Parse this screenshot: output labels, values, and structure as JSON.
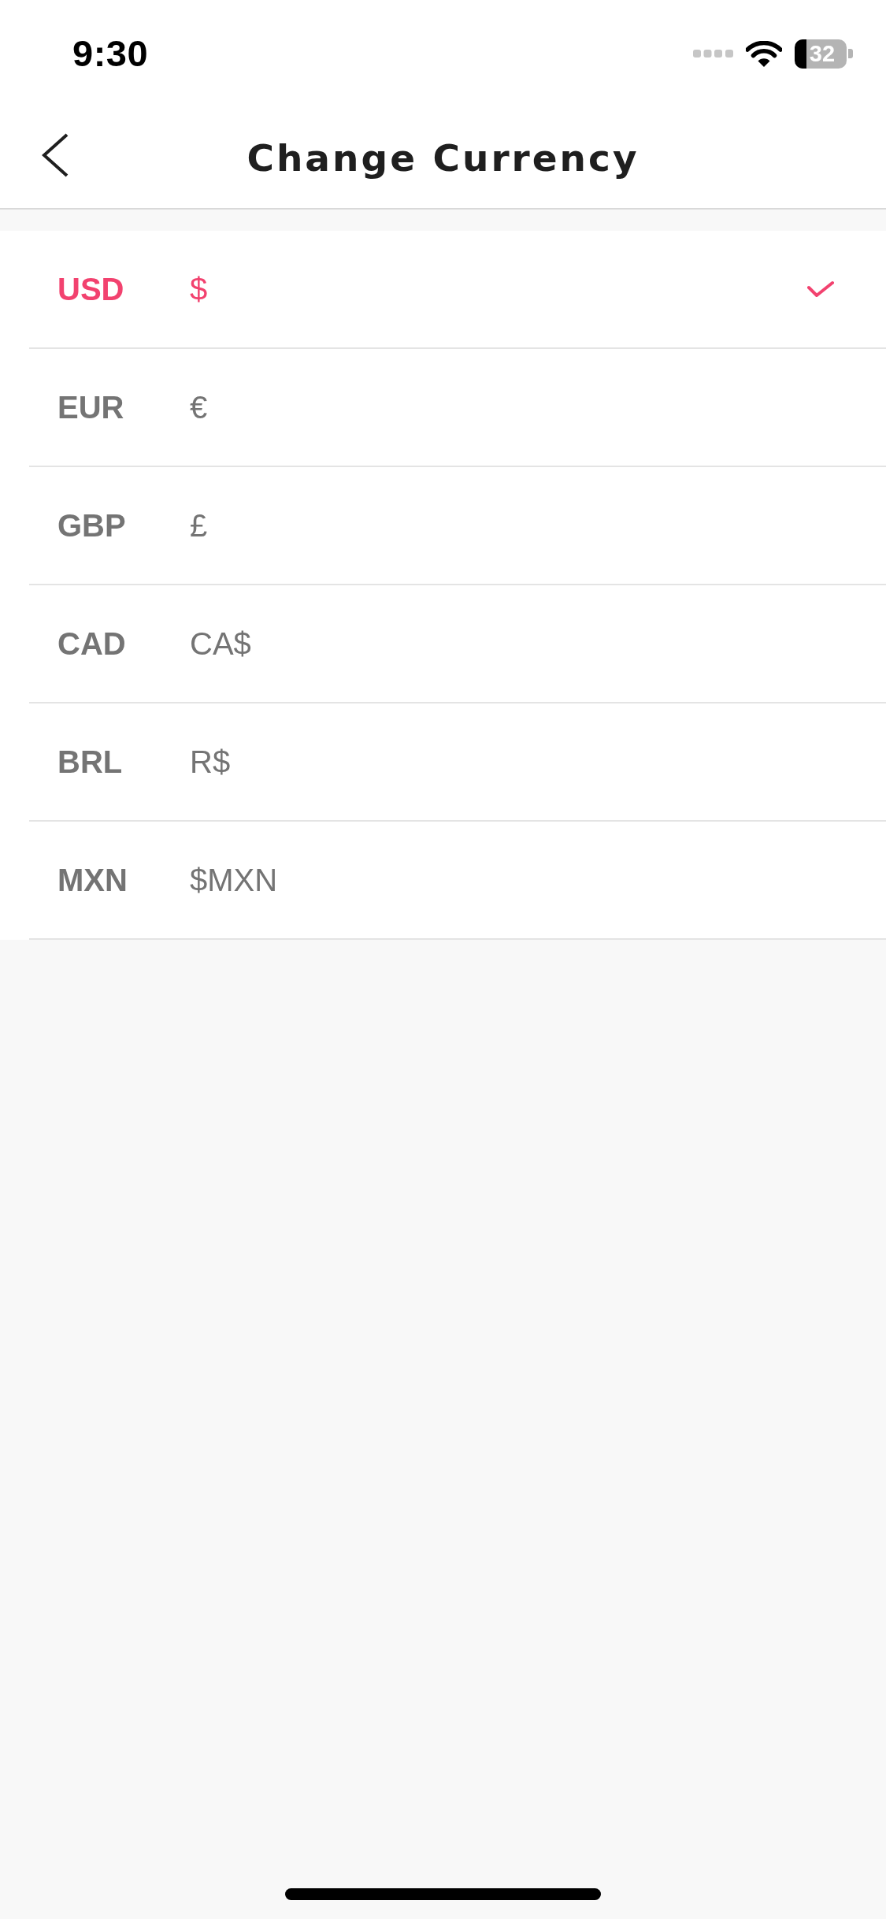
{
  "status_bar": {
    "time": "9:30",
    "battery": "32"
  },
  "nav_bar": {
    "title": "Change Currency"
  },
  "currencies": [
    {
      "code": "USD",
      "symbol": "$",
      "selected": true
    },
    {
      "code": "EUR",
      "symbol": "€",
      "selected": false
    },
    {
      "code": "GBP",
      "symbol": "£",
      "selected": false
    },
    {
      "code": "CAD",
      "symbol": "CA$",
      "selected": false
    },
    {
      "code": "BRL",
      "symbol": "R$",
      "selected": false
    },
    {
      "code": "MXN",
      "symbol": "$MXN",
      "selected": false
    }
  ]
}
